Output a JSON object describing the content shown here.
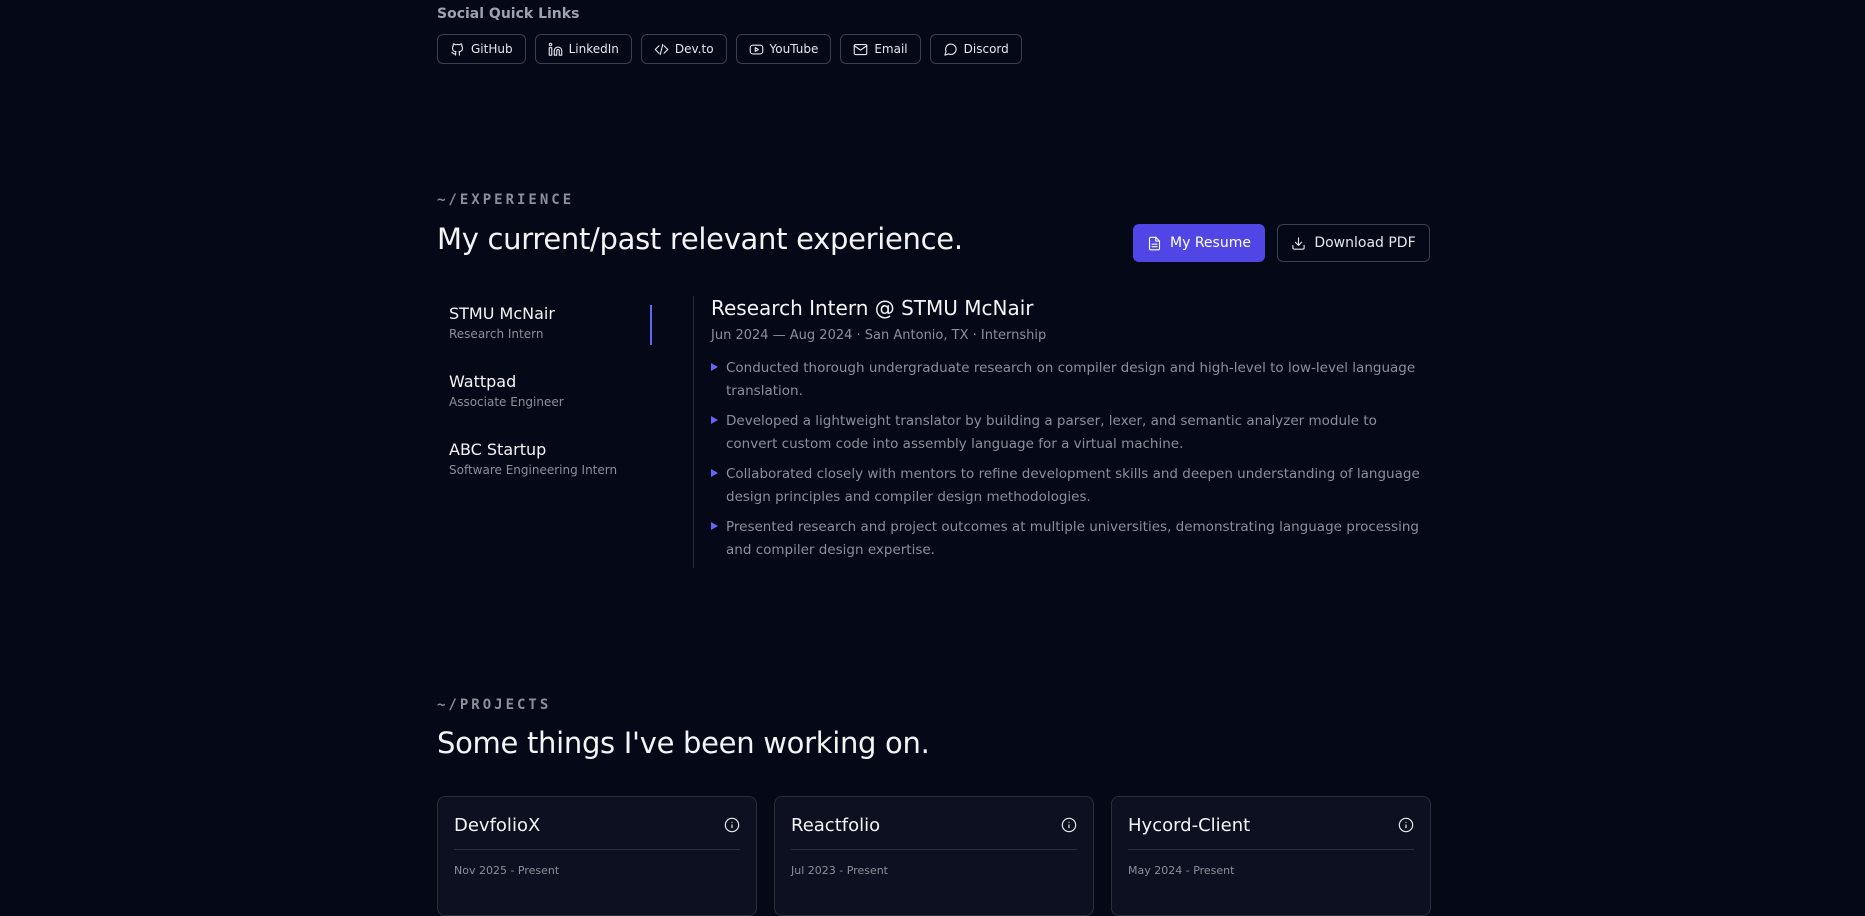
{
  "social": {
    "title": "Social Quick Links",
    "links": [
      {
        "label": "GitHub",
        "icon": "github-icon"
      },
      {
        "label": "LinkedIn",
        "icon": "linkedin-icon"
      },
      {
        "label": "Dev.to",
        "icon": "code-icon"
      },
      {
        "label": "YouTube",
        "icon": "youtube-icon"
      },
      {
        "label": "Email",
        "icon": "mail-icon"
      },
      {
        "label": "Discord",
        "icon": "chat-icon"
      }
    ]
  },
  "experience": {
    "eyebrow": "~/EXPERIENCE",
    "heading": "My current/past relevant experience.",
    "resume_label": "My Resume",
    "download_label": "Download PDF",
    "items": [
      {
        "company": "STMU McNair",
        "role": "Research Intern",
        "active": true
      },
      {
        "company": "Wattpad",
        "role": "Associate Engineer",
        "active": false
      },
      {
        "company": "ABC Startup",
        "role": "Software Engineering Intern",
        "active": false
      }
    ],
    "detail": {
      "title": "Research Intern @ STMU McNair",
      "meta": "Jun 2024 — Aug 2024 · San Antonio, TX · Internship",
      "bullets": [
        "Conducted thorough undergraduate research on compiler design and high-level to low-level language translation.",
        "Developed a lightweight translator by building a parser, lexer, and semantic analyzer module to convert custom code into assembly language for a virtual machine.",
        "Collaborated closely with mentors to refine development skills and deepen understanding of language design principles and compiler design methodologies.",
        "Presented research and project outcomes at multiple universities, demonstrating language processing and compiler design expertise."
      ]
    }
  },
  "projects": {
    "eyebrow": "~/PROJECTS",
    "heading": "Some things I've been working on.",
    "cards": [
      {
        "name": "DevfolioX",
        "date": "Nov 2025 - Present"
      },
      {
        "name": "Reactfolio",
        "date": "Jul 2023 - Present"
      },
      {
        "name": "Hycord-Client",
        "date": "May 2024 - Present"
      }
    ]
  },
  "colors": {
    "background": "#050816",
    "accent": "#4f46e5",
    "muted": "#8b8f99"
  }
}
